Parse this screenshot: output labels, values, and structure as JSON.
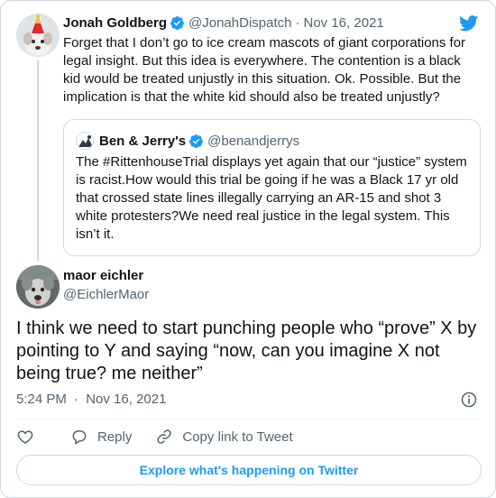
{
  "parent_tweet": {
    "author_name": "Jonah Goldberg",
    "author_handle": "@JonahDispatch",
    "separator": "·",
    "date": "Nov 16, 2021",
    "text": "Forget that I don’t go to ice cream mascots of giant corporations for legal insight. But this idea is everywhere. The contention is a black kid would be treated unjustly in this situation. Ok. Possible. But the implication is that the white kid should also be treated unjustly?",
    "verified": true,
    "avatar_icon": "dog-with-party-hat-avatar"
  },
  "quoted_tweet": {
    "author_name": "Ben & Jerry's",
    "author_handle": "@benandjerrys",
    "text": "The #RittenhouseTrial displays yet again that our “justice” system is racist.How would this trial be going if he was a Black 17 yr old that crossed state lines illegally carrying an AR-15 and shot 3 white protesters?We need real justice in the legal system. This isn’t it.",
    "verified": true,
    "avatar_icon": "ben-and-jerrys-logo"
  },
  "main_tweet": {
    "author_name": "maor eichler",
    "author_handle": "@EichlerMaor",
    "text": "I think we need to start punching people who “prove” X by pointing to Y and saying “now, can you imagine X not being true? me neither”",
    "time": "5:24 PM",
    "separator": "·",
    "date": "Nov 16, 2021",
    "avatar_icon": "dog-photo-avatar"
  },
  "actions": {
    "reply_label": "Reply",
    "copy_link_label": "Copy link to Tweet"
  },
  "explore_label": "Explore what's happening on Twitter",
  "colors": {
    "accent": "#1d9bf0",
    "text": "#0f1419",
    "secondary_text": "#536471",
    "border": "#cfd9de"
  }
}
